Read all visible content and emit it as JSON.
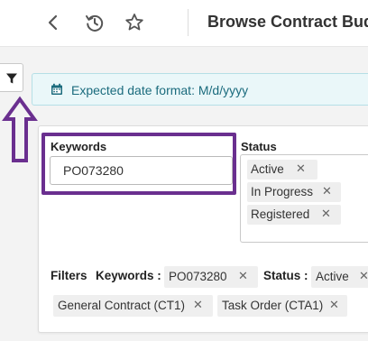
{
  "header": {
    "title": "Browse Contract Budgets",
    "icons": [
      "back-chevron-icon",
      "history-icon",
      "star-icon"
    ]
  },
  "sidebar": {
    "filter_toggle_icon": "filter-funnel-icon"
  },
  "banner": {
    "text": "Expected date format: M/d/yyyy",
    "icon": "calendar-icon"
  },
  "keywords": {
    "label": "Keywords",
    "value": "PO073280"
  },
  "status": {
    "label": "Status",
    "chips": [
      {
        "label": "Active"
      },
      {
        "label": "In Progress"
      },
      {
        "label": "Registered"
      }
    ]
  },
  "filters_bar": {
    "label": "Filters",
    "keywords_key": "Keywords :",
    "keywords_value": "PO073280",
    "status_key": "Status :",
    "status_value": "Active",
    "chips_row2": [
      {
        "label": "General Contract (CT1)"
      },
      {
        "label": "Task Order (CTA1)"
      }
    ]
  },
  "colors": {
    "highlight": "#6a2f8f",
    "banner_bg": "#eaf7f9",
    "banner_text": "#1b6b7d",
    "chip_bg": "#eeeeee"
  }
}
